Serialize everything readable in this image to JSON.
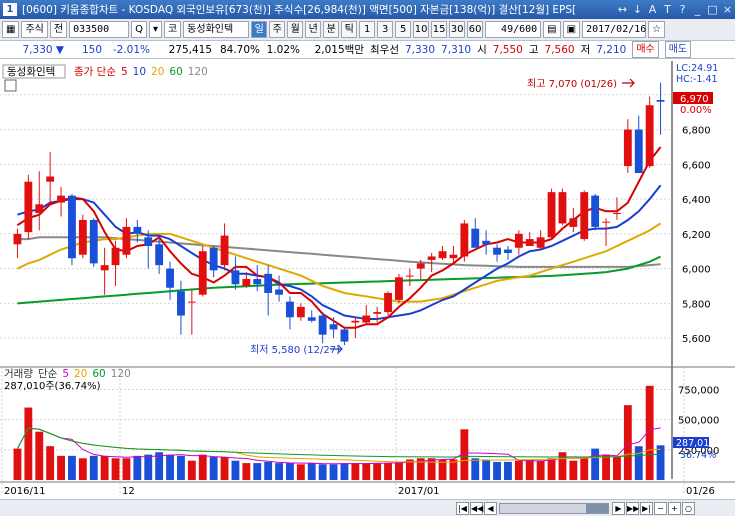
{
  "window": {
    "number": "1",
    "title": "[0600] 키움종합차트 - KOSDAQ 외국인보유[673(천)] 주식수[26,984(천)] 액면[500] 자본금[138(억)] 결산[12월] EPS[",
    "tools": [
      "↔",
      "↓",
      "A",
      "T",
      "?",
      "_",
      "□",
      "×"
    ]
  },
  "toolbar": {
    "type": "주식",
    "cond": "전",
    "code": "033500",
    "search": "Q",
    "ko": "코",
    "stock": "동성화인텍",
    "periods": [
      "일",
      "주",
      "월",
      "년",
      "분",
      "틱"
    ],
    "periods_sel": 0,
    "mins": [
      "1",
      "3",
      "5",
      "10",
      "15",
      "30",
      "60"
    ],
    "pages": "49/600",
    "date": "2017/02/16",
    "fav": "☆"
  },
  "quote": {
    "price": "7,330 ▼",
    "chg": "150",
    "pct": "-2.01%",
    "vol": "275,415",
    "vol_ratio": "84.70%",
    "turn": "1.02%",
    "amount": "2,015백만",
    "bid_label": "최우선",
    "bid1": "7,330",
    "bid2": "7,310",
    "open_l": "시",
    "open": "7,550",
    "high_l": "고",
    "high": "7,560",
    "low_l": "저",
    "low": "7,210",
    "buy": "매수",
    "sell": "매도"
  },
  "chart_data": {
    "type": "candlestick",
    "name": "동성화인텍",
    "legend": [
      {
        "text": "종가 단순",
        "color": "#d80000"
      },
      {
        "text": "5",
        "color": "#d80000"
      },
      {
        "text": "10",
        "color": "#1a3fd0"
      },
      {
        "text": "20",
        "color": "#e0a800"
      },
      {
        "text": "60",
        "color": "#0a9a2c"
      },
      {
        "text": "120",
        "color": "#888888"
      }
    ],
    "yticks": [
      "7,000",
      "6,800",
      "6,600",
      "6,400",
      "6,200",
      "6,000",
      "5,800",
      "5,600"
    ],
    "ylim": [
      5480,
      7160
    ],
    "current": "6,970",
    "pct_label": "0.00%",
    "lc": "LC:24.91",
    "hc": "HC:-1.41",
    "high_ann": "최고 7,070 (01/26)",
    "low_ann": "최저 5,580 (12/27)",
    "xlabels": [
      "2016/11",
      "12",
      "2017/01",
      "01/26"
    ],
    "candles": [
      [
        6140,
        6230,
        6060,
        6200
      ],
      [
        6210,
        6540,
        6170,
        6500
      ],
      [
        6320,
        6560,
        6220,
        6370
      ],
      [
        6500,
        6670,
        6370,
        6530
      ],
      [
        6380,
        6470,
        6300,
        6420
      ],
      [
        6420,
        6430,
        6020,
        6060
      ],
      [
        6080,
        6310,
        6060,
        6280
      ],
      [
        6280,
        6290,
        6010,
        6030
      ],
      [
        5990,
        6120,
        5850,
        6020
      ],
      [
        6020,
        6160,
        5900,
        6120
      ],
      [
        6080,
        6290,
        6060,
        6240
      ],
      [
        6240,
        6280,
        6150,
        6200
      ],
      [
        6180,
        6220,
        6000,
        6130
      ],
      [
        6140,
        6180,
        5970,
        6020
      ],
      [
        6000,
        6040,
        5820,
        5890
      ],
      [
        5870,
        5930,
        5620,
        5730
      ],
      [
        5810,
        5880,
        5620,
        5810
      ],
      [
        5850,
        6130,
        5840,
        6100
      ],
      [
        6120,
        6130,
        5950,
        5990
      ],
      [
        6020,
        6260,
        5990,
        6190
      ],
      [
        5990,
        6070,
        5880,
        5910
      ],
      [
        5900,
        5980,
        5890,
        5940
      ],
      [
        5940,
        6020,
        5870,
        5910
      ],
      [
        5970,
        6020,
        5730,
        5860
      ],
      [
        5880,
        5960,
        5810,
        5850
      ],
      [
        5810,
        5840,
        5650,
        5720
      ],
      [
        5720,
        5800,
        5700,
        5780
      ],
      [
        5720,
        5760,
        5690,
        5700
      ],
      [
        5730,
        5750,
        5570,
        5620
      ],
      [
        5680,
        5720,
        5600,
        5650
      ],
      [
        5650,
        5660,
        5560,
        5580
      ],
      [
        5690,
        5720,
        5600,
        5700
      ],
      [
        5690,
        5790,
        5680,
        5730
      ],
      [
        5740,
        5780,
        5690,
        5750
      ],
      [
        5750,
        5870,
        5730,
        5860
      ],
      [
        5820,
        5970,
        5800,
        5950
      ],
      [
        5960,
        6000,
        5900,
        5960
      ],
      [
        6000,
        6050,
        5940,
        6030
      ],
      [
        6050,
        6090,
        5980,
        6070
      ],
      [
        6060,
        6130,
        6050,
        6100
      ],
      [
        6060,
        6130,
        6030,
        6080
      ],
      [
        6070,
        6280,
        6040,
        6260
      ],
      [
        6230,
        6290,
        6220,
        6120
      ],
      [
        6160,
        6220,
        6080,
        6140
      ],
      [
        6120,
        6140,
        6040,
        6080
      ],
      [
        6110,
        6130,
        6050,
        6090
      ],
      [
        6120,
        6220,
        6080,
        6200
      ],
      [
        6130,
        6210,
        6130,
        6170
      ],
      [
        6120,
        6220,
        6110,
        6180
      ],
      [
        6180,
        6460,
        6170,
        6440
      ],
      [
        6260,
        6460,
        6250,
        6440
      ],
      [
        6240,
        6350,
        6210,
        6290
      ],
      [
        6170,
        6450,
        6160,
        6440
      ],
      [
        6420,
        6430,
        6220,
        6240
      ],
      [
        6270,
        6290,
        6130,
        6270
      ],
      [
        6320,
        6410,
        6280,
        6320
      ],
      [
        6590,
        6860,
        6550,
        6800
      ],
      [
        6800,
        6880,
        6570,
        6550
      ],
      [
        6590,
        6990,
        6580,
        6940
      ],
      [
        6970,
        7070,
        6770,
        6960
      ]
    ],
    "ma5": [
      6250,
      6290,
      6310,
      6370,
      6390,
      6410,
      6400,
      6330,
      6210,
      6110,
      6100,
      6130,
      6140,
      6180,
      6100,
      6030,
      5970,
      5950,
      5920,
      5960,
      6010,
      6010,
      5960,
      5950,
      5920,
      5860,
      5860,
      5810,
      5740,
      5700,
      5660,
      5660,
      5680,
      5680,
      5720,
      5780,
      5830,
      5890,
      5960,
      5990,
      6030,
      6080,
      6110,
      6140,
      6150,
      6170,
      6150,
      6150,
      6150,
      6170,
      6230,
      6280,
      6330,
      6350,
      6330,
      6330,
      6380,
      6500,
      6620,
      6700
    ],
    "ma10": [
      6310,
      6330,
      6340,
      6380,
      6390,
      6400,
      6400,
      6380,
      6310,
      6240,
      6200,
      6210,
      6190,
      6190,
      6170,
      6130,
      6090,
      6050,
      6020,
      6000,
      5970,
      5970,
      5960,
      5950,
      5910,
      5900,
      5880,
      5840,
      5790,
      5760,
      5730,
      5720,
      5710,
      5710,
      5720,
      5730,
      5740,
      5760,
      5790,
      5820,
      5840,
      5880,
      5920,
      5960,
      6000,
      6030,
      6070,
      6100,
      6110,
      6130,
      6160,
      6190,
      6220,
      6230,
      6230,
      6240,
      6280,
      6330,
      6400,
      6480
    ],
    "ma20": [
      6000,
      6030,
      6050,
      6080,
      6110,
      6130,
      6150,
      6160,
      6170,
      6170,
      6180,
      6190,
      6200,
      6200,
      6200,
      6180,
      6160,
      6140,
      6120,
      6100,
      6080,
      6060,
      6040,
      6020,
      6000,
      5980,
      5960,
      5930,
      5900,
      5880,
      5860,
      5850,
      5840,
      5830,
      5820,
      5810,
      5810,
      5810,
      5820,
      5830,
      5850,
      5870,
      5890,
      5910,
      5930,
      5940,
      5950,
      5960,
      5980,
      6000,
      6020,
      6040,
      6060,
      6080,
      6100,
      6130,
      6160,
      6190,
      6220,
      6260
    ],
    "ma60": [
      5800,
      5805,
      5810,
      5815,
      5820,
      5825,
      5830,
      5835,
      5840,
      5845,
      5850,
      5855,
      5860,
      5865,
      5870,
      5875,
      5880,
      5885,
      5890,
      5893,
      5896,
      5899,
      5902,
      5905,
      5908,
      5910,
      5912,
      5914,
      5916,
      5918,
      5920,
      5922,
      5924,
      5926,
      5928,
      5930,
      5932,
      5934,
      5936,
      5938,
      5940,
      5942,
      5944,
      5946,
      5948,
      5950,
      5952,
      5954,
      5956,
      5958,
      5962,
      5966,
      5970,
      5975,
      5980,
      5990,
      6000,
      6020,
      6040,
      6070
    ],
    "ma120": [
      6170,
      6170,
      6180,
      6180,
      6180,
      6180,
      6180,
      6180,
      6180,
      6175,
      6170,
      6165,
      6160,
      6155,
      6150,
      6145,
      6140,
      6135,
      6130,
      6125,
      6120,
      6115,
      6110,
      6105,
      6100,
      6095,
      6090,
      6085,
      6080,
      6075,
      6070,
      6065,
      6060,
      6055,
      6050,
      6045,
      6040,
      6036,
      6032,
      6028,
      6024,
      6020,
      6018,
      6016,
      6014,
      6012,
      6010,
      6010,
      6010,
      6010,
      6010,
      6010,
      6010,
      6010,
      6010,
      6010,
      6010,
      6015,
      6020,
      6025
    ],
    "volume": {
      "legend": [
        {
          "text": "거래량",
          "color": "#333"
        },
        {
          "text": "단순",
          "color": "#333"
        },
        {
          "text": "5",
          "color": "#cc00cc"
        },
        {
          "text": "20",
          "color": "#e0a800"
        },
        {
          "text": "60",
          "color": "#0a9a2c"
        },
        {
          "text": "120",
          "color": "#888888"
        }
      ],
      "current": "287,010주(36.74%)",
      "yticks": [
        "750,000",
        "500,000",
        "250,000"
      ],
      "ylim": [
        0,
        820000
      ],
      "cur_val": "287,010",
      "cur_pct": "36.74%",
      "values": [
        260000,
        600000,
        400000,
        280000,
        200000,
        200000,
        180000,
        200000,
        200000,
        180000,
        180000,
        200000,
        210000,
        230000,
        210000,
        200000,
        160000,
        210000,
        190000,
        190000,
        160000,
        140000,
        140000,
        150000,
        140000,
        140000,
        130000,
        140000,
        130000,
        130000,
        140000,
        140000,
        140000,
        140000,
        140000,
        150000,
        170000,
        180000,
        180000,
        170000,
        170000,
        420000,
        180000,
        170000,
        150000,
        150000,
        160000,
        170000,
        160000,
        180000,
        230000,
        160000,
        180000,
        260000,
        210000,
        190000,
        620000,
        280000,
        780000,
        287010
      ]
    }
  }
}
